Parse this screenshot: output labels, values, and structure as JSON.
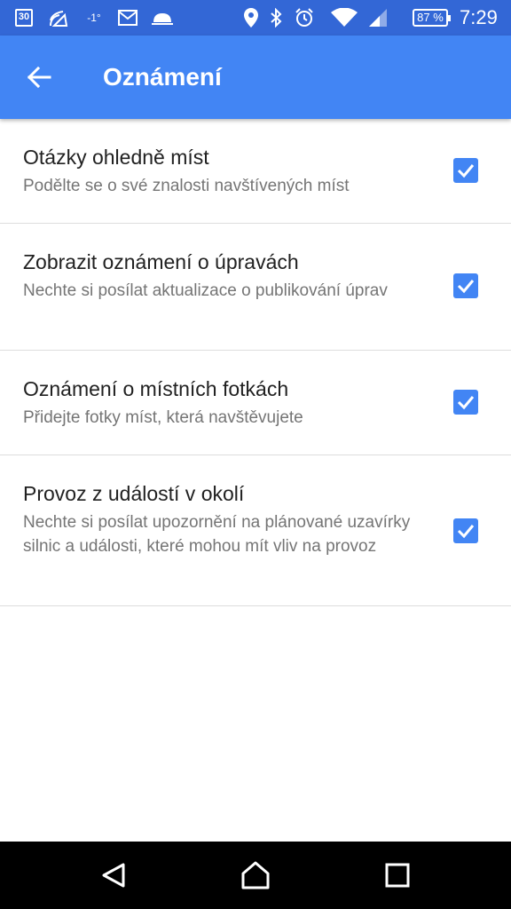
{
  "status_bar": {
    "calendar_day": "30",
    "temperature": "-1°",
    "battery_percent": "87 %",
    "time": "7:29",
    "icons": [
      "calendar-icon",
      "nfc-icon",
      "gmail-icon",
      "weather-icon",
      "location-icon",
      "bluetooth-icon",
      "alarm-icon",
      "wifi-icon",
      "signal-icon",
      "battery-icon"
    ]
  },
  "app_bar": {
    "title": "Oznámení",
    "color": "#4285f4",
    "status_color": "#3367d6"
  },
  "settings": [
    {
      "title": "Otázky ohledně míst",
      "summary": "Podělte se o své znalosti navštívených míst",
      "checked": true
    },
    {
      "title": "Zobrazit oznámení o úpravách",
      "summary": "Nechte si posílat aktualizace o publikování úprav",
      "checked": true
    },
    {
      "title": "Oznámení o místních fotkách",
      "summary": "Přidejte fotky míst, která navštěvujete",
      "checked": true
    },
    {
      "title": "Provoz z událostí v okolí",
      "summary": "Nechte si posílat upozornění na plánované uzavírky silnic a události, které mohou mít vliv na provoz",
      "checked": true
    }
  ],
  "nav_bar": {
    "icons": [
      "back-triangle-icon",
      "home-icon",
      "recents-icon"
    ]
  }
}
